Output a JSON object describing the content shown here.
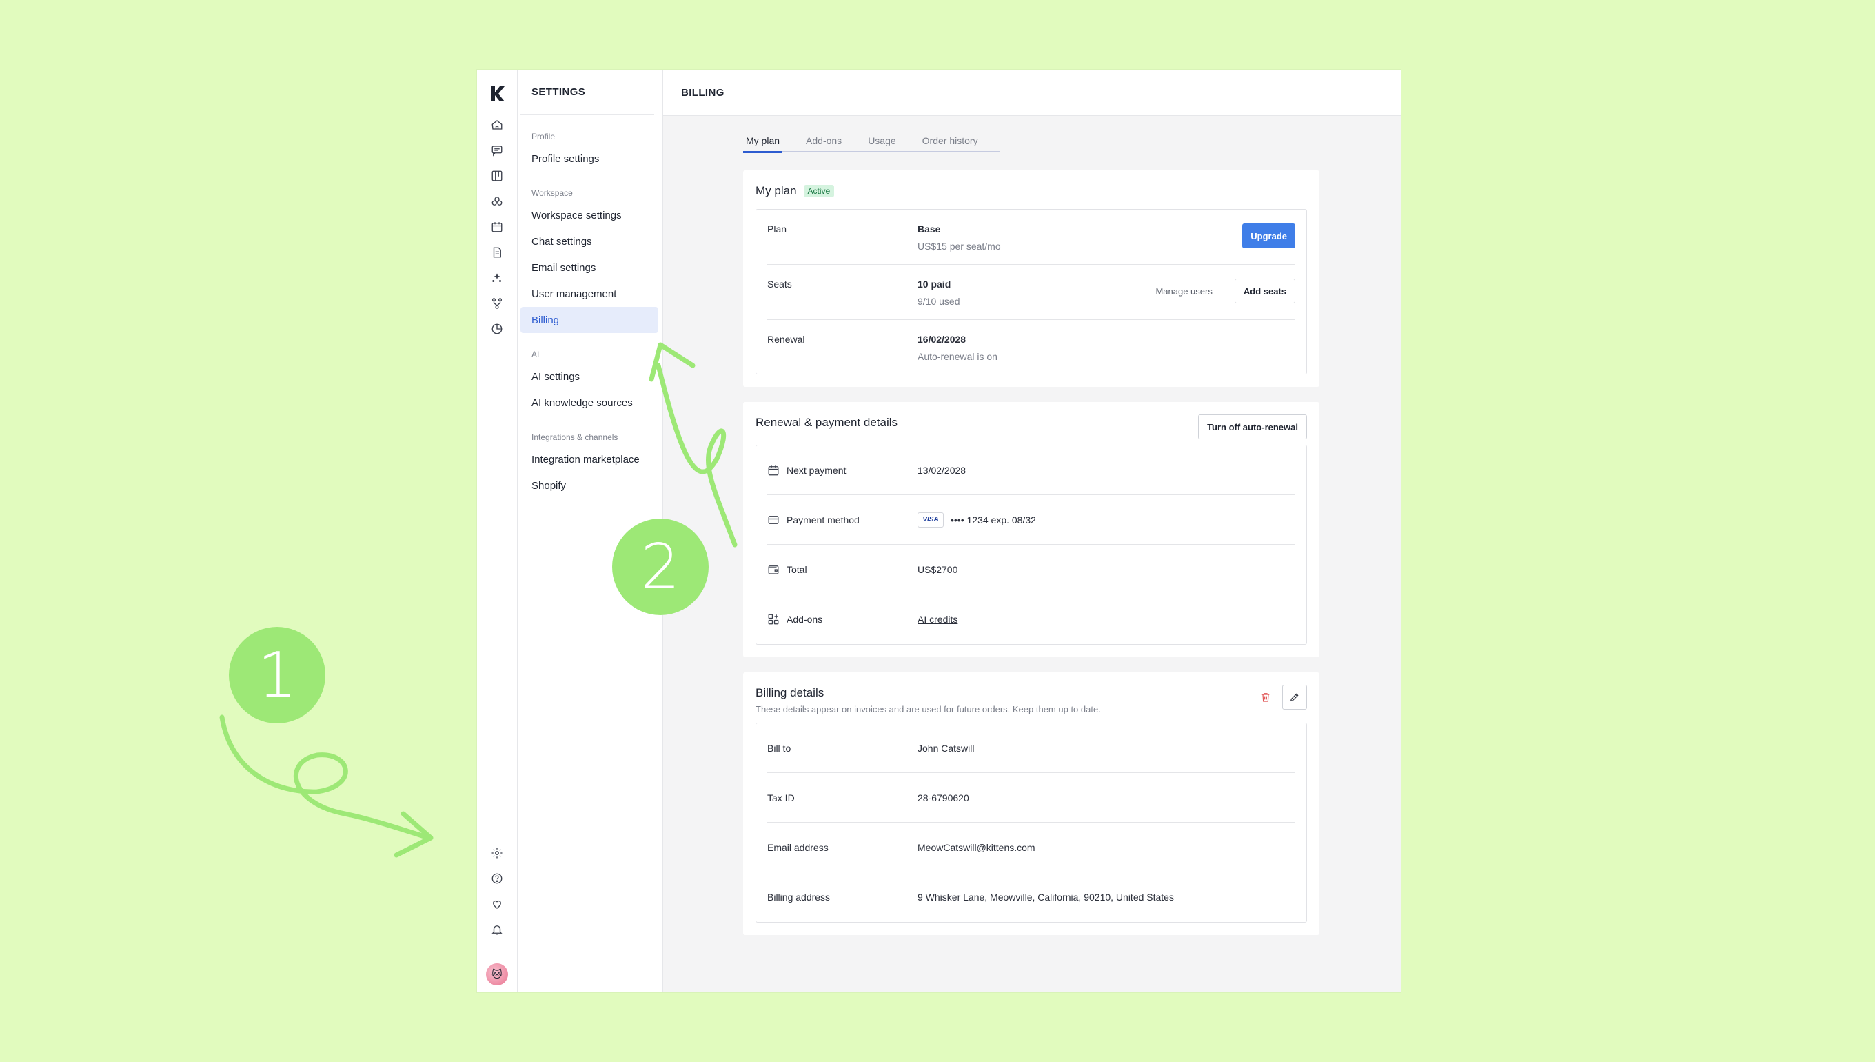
{
  "nav": {
    "header": "SETTINGS",
    "sections": [
      {
        "title": "Profile",
        "items": [
          {
            "label": "Profile settings"
          }
        ]
      },
      {
        "title": "Workspace",
        "items": [
          {
            "label": "Workspace settings"
          },
          {
            "label": "Chat settings"
          },
          {
            "label": "Email settings"
          },
          {
            "label": "User management"
          },
          {
            "label": "Billing",
            "active": true
          }
        ]
      },
      {
        "title": "AI",
        "items": [
          {
            "label": "AI settings"
          },
          {
            "label": "AI knowledge sources"
          }
        ]
      },
      {
        "title": "Integrations & channels",
        "items": [
          {
            "label": "Integration marketplace"
          },
          {
            "label": "Shopify"
          }
        ]
      }
    ]
  },
  "rail": {
    "logo": "kustomer-logo-icon",
    "top_icons": [
      "home-icon",
      "chat-icon",
      "board-icon",
      "team-icon",
      "calendar-icon",
      "document-icon",
      "ai-sparkle-icon",
      "workflow-icon",
      "reports-icon"
    ],
    "bottom_icons": [
      "gear-icon",
      "help-icon",
      "heart-icon",
      "bell-icon"
    ]
  },
  "topbar": {
    "title": "BILLING"
  },
  "tabs": [
    {
      "label": "My plan",
      "active": true
    },
    {
      "label": "Add-ons"
    },
    {
      "label": "Usage"
    },
    {
      "label": "Order history"
    }
  ],
  "plan": {
    "title": "My plan",
    "badge": "Active",
    "rows": {
      "plan": {
        "label": "Plan",
        "value": "Base",
        "sub": "US$15 per seat/mo",
        "upgrade": "Upgrade"
      },
      "seats": {
        "label": "Seats",
        "value": "10 paid",
        "sub": "9/10 used",
        "manage": "Manage users",
        "add": "Add seats"
      },
      "renewal": {
        "label": "Renewal",
        "value": "16/02/2028",
        "sub": "Auto-renewal is on"
      }
    }
  },
  "payment": {
    "title": "Renewal & payment details",
    "turn_off": "Turn off auto-renewal",
    "next_payment": {
      "label": "Next payment",
      "value": "13/02/2028"
    },
    "method": {
      "label": "Payment method",
      "card_brand": "VISA",
      "value": "•••• 1234  exp. 08/32"
    },
    "total": {
      "label": "Total",
      "value": "US$2700"
    },
    "addons": {
      "label": "Add-ons",
      "value": "AI credits"
    }
  },
  "billing": {
    "title": "Billing details",
    "description": "These details appear on invoices and are used for future orders. Keep them up to date.",
    "rows": {
      "bill_to": {
        "label": "Bill to",
        "value": "John Catswill"
      },
      "tax_id": {
        "label": "Tax ID",
        "value": "28-6790620"
      },
      "email": {
        "label": "Email address",
        "value": "MeowCatswill@kittens.com"
      },
      "address": {
        "label": "Billing address",
        "value": "9 Whisker Lane, Meowville, California, 90210, United States"
      }
    }
  },
  "annotations": {
    "one": "1",
    "two": "2"
  },
  "colors": {
    "background": "#e1fbbe",
    "accent": "#3f7ee8",
    "annotation": "#9de876"
  }
}
